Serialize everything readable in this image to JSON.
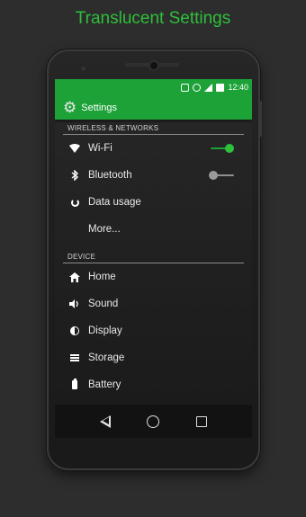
{
  "promo": {
    "title": "Translucent Settings"
  },
  "status_bar": {
    "time": "12:40",
    "icons": [
      "vibrate-icon",
      "alarm-icon",
      "signal-icon",
      "battery-icon"
    ]
  },
  "app_bar": {
    "title": "Settings",
    "icon": "gear-icon"
  },
  "sections": {
    "wireless": {
      "header": "WIRELESS & NETWORKS",
      "items": [
        {
          "label": "Wi-Fi",
          "icon": "wifi-icon",
          "toggle": true
        },
        {
          "label": "Bluetooth",
          "icon": "bluetooth-icon",
          "toggle": false
        },
        {
          "label": "Data usage",
          "icon": "data-usage-icon"
        },
        {
          "label": "More...",
          "icon": ""
        }
      ]
    },
    "device": {
      "header": "DEVICE",
      "items": [
        {
          "label": "Home",
          "icon": "home-icon"
        },
        {
          "label": "Sound",
          "icon": "sound-icon"
        },
        {
          "label": "Display",
          "icon": "display-icon"
        },
        {
          "label": "Storage",
          "icon": "storage-icon"
        },
        {
          "label": "Battery",
          "icon": "battery-icon"
        }
      ]
    }
  },
  "navigation": {
    "buttons": [
      "back-icon",
      "home-circle-icon",
      "recent-apps-icon"
    ]
  },
  "colors": {
    "accent": "#1ca237",
    "background": "#2d2d2d",
    "title": "#2fbf3b"
  }
}
